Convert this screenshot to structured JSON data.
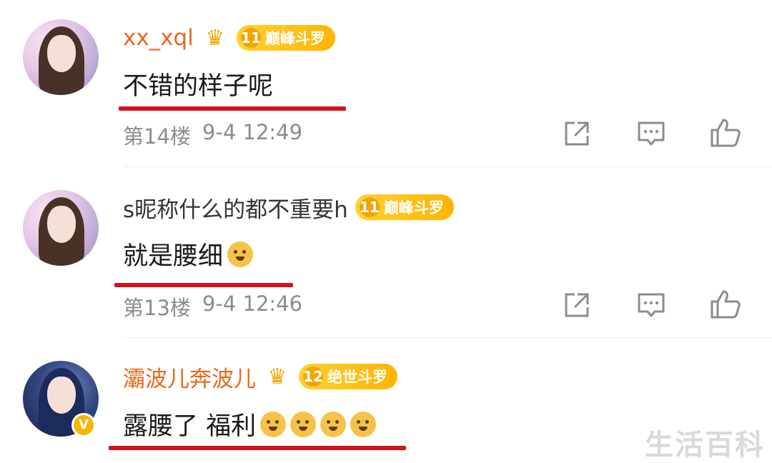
{
  "comments": [
    {
      "username": "xx_xql",
      "name_style": "orange",
      "has_crown": true,
      "badge_level": "11",
      "badge_title": "巅峰斗罗",
      "text": "不错的样子呢",
      "emojis": 0,
      "floor": "第14楼",
      "time": "9-4 12:49"
    },
    {
      "username": "s昵称什么的都不重要h",
      "name_style": "gray",
      "has_crown": false,
      "badge_level": "11",
      "badge_title": "巅峰斗罗",
      "text": "就是腰细",
      "emojis": 1,
      "floor": "第13楼",
      "time": "9-4 12:46"
    },
    {
      "username": "灞波儿奔波儿",
      "name_style": "orange",
      "has_crown": true,
      "badge_level": "12",
      "badge_title": "绝世斗罗",
      "text": "露腰了 福利",
      "emojis": 4,
      "verified": true
    }
  ],
  "icons": {
    "share": "share-icon",
    "reply": "comment-icon",
    "like": "thumbs-up-icon",
    "crown": "crown-icon"
  },
  "colors": {
    "username_orange": "#e8691b",
    "badge_yellow": "#ffc21a",
    "underline_red": "#d4131b",
    "meta_gray": "#8c8c8c"
  },
  "watermark": "生活百科"
}
